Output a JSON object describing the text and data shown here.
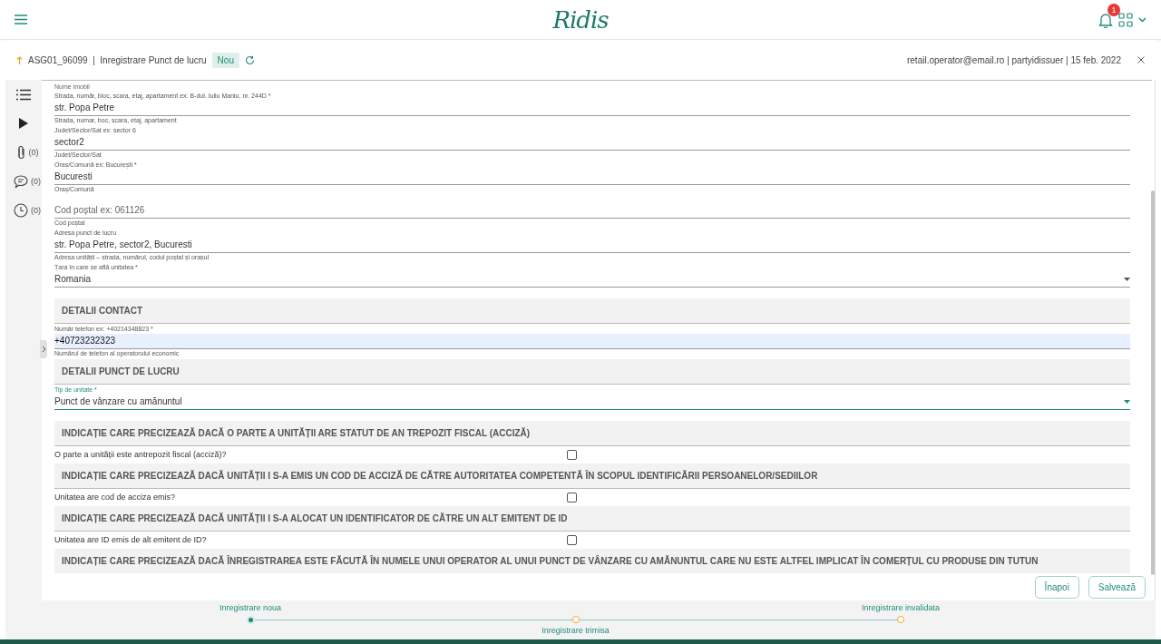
{
  "header": {
    "logo": "Ridis",
    "notifications": "1"
  },
  "record": {
    "id": "ASG01_96099",
    "separator": "|",
    "title": "Inregistrare Punct de lucru",
    "status": "Nou",
    "meta": "retail.operator@email.ro | partyidissuer | 15 feb. 2022"
  },
  "rail": [
    {
      "kind": "list"
    },
    {
      "kind": "play"
    },
    {
      "kind": "attachments",
      "count": "(0)"
    },
    {
      "kind": "comments",
      "count": "(0)"
    },
    {
      "kind": "history",
      "count": "(0)"
    }
  ],
  "form": [
    {
      "kind": "note",
      "text": "Nume imobil"
    },
    {
      "kind": "field",
      "label": "Strada, număr, bloc, scara, etaj, apartament ex: B-dul. Iuliu Maniu, nr. 244D *",
      "value": "str. Popa Petre",
      "hint": "Strada, numar, boc, scara, etaj, apartament",
      "focused": false,
      "highlighted": false
    },
    {
      "kind": "field",
      "label": "Judet/Sector/Sat ex: sector 6",
      "value": "sector2",
      "hint": "Judet/Sector/Sat",
      "focused": false,
      "highlighted": false
    },
    {
      "kind": "field",
      "label": "Oraș/Comună ex: București *",
      "value": "Bucuresti",
      "hint": "Oraș/Comună",
      "focused": false,
      "highlighted": false
    },
    {
      "kind": "field",
      "placeholder": "Cod poștal ex: 061126",
      "hint": "Cod poștal",
      "focused": false,
      "highlighted": false
    },
    {
      "kind": "field",
      "label": "Adresa punct de lucru",
      "value": "str. Popa Petre, sector2, Bucuresti",
      "hint": "Adresa unității – strada, numărul, codul poștal și orașul",
      "focused": false,
      "highlighted": false
    },
    {
      "kind": "select",
      "label": "Țara în care se află unitatea *",
      "value": "Romania",
      "focused": false
    },
    {
      "kind": "section",
      "text": "DETALII CONTACT"
    },
    {
      "kind": "field",
      "label": "Număr telefon ex: +40214348823 *",
      "value": "+40723232323",
      "hint": "Numărul de telefon al operatorului economic",
      "focused": false,
      "highlighted": true
    },
    {
      "kind": "section",
      "text": "DETALII PUNCT DE LUCRU"
    },
    {
      "kind": "select",
      "label": "Tip de unitate *",
      "value": "Punct de vânzare cu amănuntul",
      "focused": true
    },
    {
      "kind": "section",
      "text": "INDICAȚIE CARE PRECIZEAZĂ DACĂ O PARTE A UNITĂȚII ARE STATUT DE AN TREPOZIT FISCAL (ACCIZĂ)"
    },
    {
      "kind": "checkbox",
      "label": "O parte a unității este antrepozit fiscal (acciză)?",
      "checked": false
    },
    {
      "kind": "section",
      "text": "INDICAȚIE CARE PRECIZEAZĂ DACĂ UNITĂȚII I S-A EMIS UN COD DE ACCIZĂ DE CĂTRE AUTORITATEA COMPETENTĂ ÎN SCOPUL IDENTIFICĂRII PERSOANELOR/SEDIILOR"
    },
    {
      "kind": "checkbox",
      "label": "Unitatea are cod de acciza emis?",
      "checked": false
    },
    {
      "kind": "section",
      "text": "INDICAȚIE CARE PRECIZEAZĂ DACĂ UNITĂȚII I S-A ALOCAT UN IDENTIFICATOR DE CĂTRE UN ALT EMITENT DE ID"
    },
    {
      "kind": "checkbox",
      "label": "Unitatea are ID emis de alt emitent de ID?",
      "checked": false
    },
    {
      "kind": "section",
      "text": "INDICAȚIE CARE PRECIZEAZĂ DACĂ ÎNREGISTRAREA ESTE FĂCUTĂ ÎN NUMELE UNUI OPERATOR AL UNUI PUNCT DE VÂNZARE CU AMĂNUNTUL CARE NU ESTE ALTFEL IMPLICAT ÎN COMERȚUL CU PRODUSE DIN TUTUN"
    }
  ],
  "buttons": [
    "Înapoi",
    "Salvează"
  ],
  "steps": [
    {
      "label": "Inregistrare noua",
      "done": true
    },
    {
      "label": "Inregistrare trimisa",
      "done": false
    },
    {
      "label": "Inregistrare invalidata",
      "done": false
    }
  ]
}
